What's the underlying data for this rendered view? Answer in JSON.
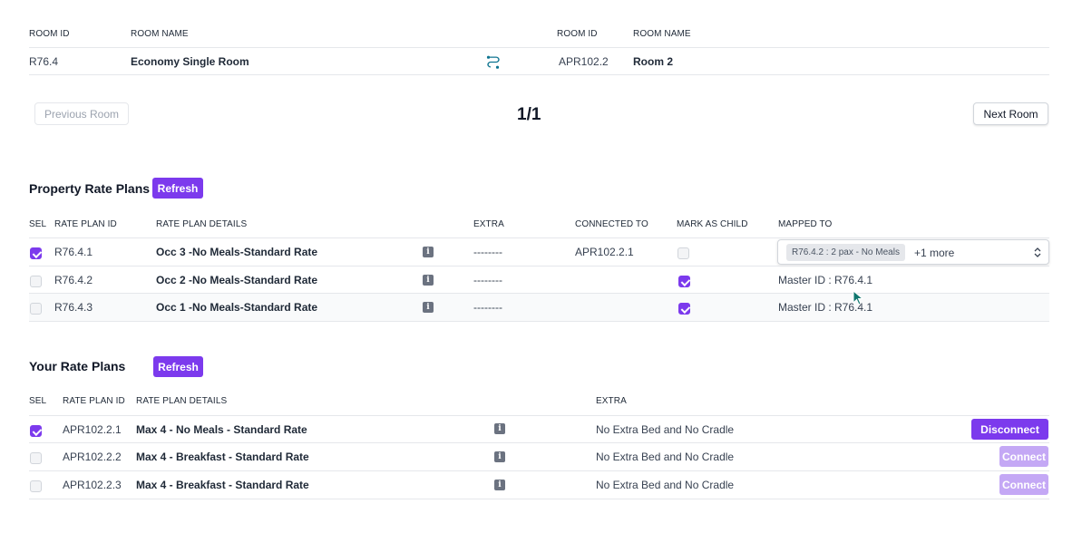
{
  "room_header": {
    "left_room_id_label": "ROOM ID",
    "left_room_name_label": "ROOM NAME",
    "right_room_id_label": "ROOM ID",
    "right_room_name_label": "ROOM NAME",
    "left_room_id": "R76.4",
    "left_room_name": "Economy Single Room",
    "right_room_id": "APR102.2",
    "right_room_name": "Room 2",
    "link_icon": "link-connection-icon"
  },
  "pager": {
    "previous_label": "Previous Room",
    "next_label": "Next Room",
    "indicator": "1/1"
  },
  "property_rate_plans": {
    "title": "Property Rate Plans",
    "refresh_label": "Refresh",
    "columns": {
      "sel": "SEL",
      "rate_plan_id": "RATE PLAN ID",
      "rate_plan_details": "RATE PLAN DETAILS",
      "extra": "EXTRA",
      "connected_to": "CONNECTED TO",
      "mark_as_child": "MARK AS CHILD",
      "mapped_to": "MAPPED TO"
    },
    "rows": [
      {
        "selected": true,
        "id": "R76.4.1",
        "details": "Occ 3  -No Meals-Standard Rate",
        "extra": "--------",
        "connected_to": "APR102.2.1",
        "child": false,
        "mapped_tag": "R76.4.2 : 2 pax - No Meals",
        "mapped_more": "+1 more"
      },
      {
        "selected": false,
        "id": "R76.4.2",
        "details": "Occ 2  -No Meals-Standard Rate",
        "extra": "--------",
        "connected_to": "",
        "child": true,
        "mapped_text": "Master ID : R76.4.1"
      },
      {
        "selected": false,
        "id": "R76.4.3",
        "details": "Occ 1 -No Meals-Standard Rate",
        "extra": "--------",
        "connected_to": "",
        "child": true,
        "mapped_text": "Master ID : R76.4.1"
      }
    ]
  },
  "your_rate_plans": {
    "title": "Your Rate Plans",
    "refresh_label": "Refresh",
    "columns": {
      "sel": "SEL",
      "rate_plan_id": "RATE PLAN ID",
      "rate_plan_details": "RATE PLAN DETAILS",
      "extra": "EXTRA"
    },
    "rows": [
      {
        "selected": true,
        "id": "APR102.2.1",
        "details": "Max 4 - No Meals - Standard Rate",
        "extra": "No Extra Bed and No Cradle",
        "action": "Disconnect"
      },
      {
        "selected": false,
        "id": "APR102.2.2",
        "details": "Max 4 - Breakfast - Standard Rate",
        "extra": "No Extra Bed and No Cradle",
        "action": "Connect"
      },
      {
        "selected": false,
        "id": "APR102.2.3",
        "details": "Max 4 - Breakfast - Standard Rate",
        "extra": "No Extra Bed and No Cradle",
        "action": "Connect"
      }
    ]
  },
  "info_icon_glyph": "i",
  "colors": {
    "accent": "#7c3aed",
    "accent_disabled": "#c4a8f5",
    "link_icon": "#0e7490"
  }
}
